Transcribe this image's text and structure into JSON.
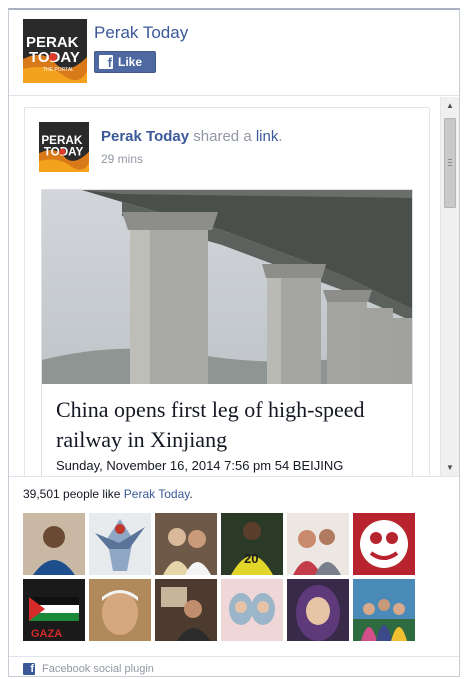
{
  "header": {
    "page_name": "Perak Today",
    "like_label": "Like",
    "logo_text": {
      "line1": "PERAK",
      "line2": "TODAY",
      "line3": "THE PORTAL"
    }
  },
  "post": {
    "author": "Perak Today",
    "action": "shared a",
    "link_text": "link",
    "period": ".",
    "time": "29 mins",
    "attachment": {
      "title": "China opens first leg of high-speed railway in Xinjiang",
      "description": "Sunday, November 16, 2014 7:56 pm  54  BEIJING"
    }
  },
  "fans": {
    "count": "39,501",
    "text": "people like",
    "page_link": "Perak Today",
    "period": ".",
    "badge_text": "20",
    "gaza_text": "GAZA"
  },
  "footer": {
    "label": "Facebook social plugin"
  },
  "colors": {
    "fb_blue": "#3b5998",
    "like_button": "#4e69a2",
    "meta_gray": "#9197a3"
  }
}
